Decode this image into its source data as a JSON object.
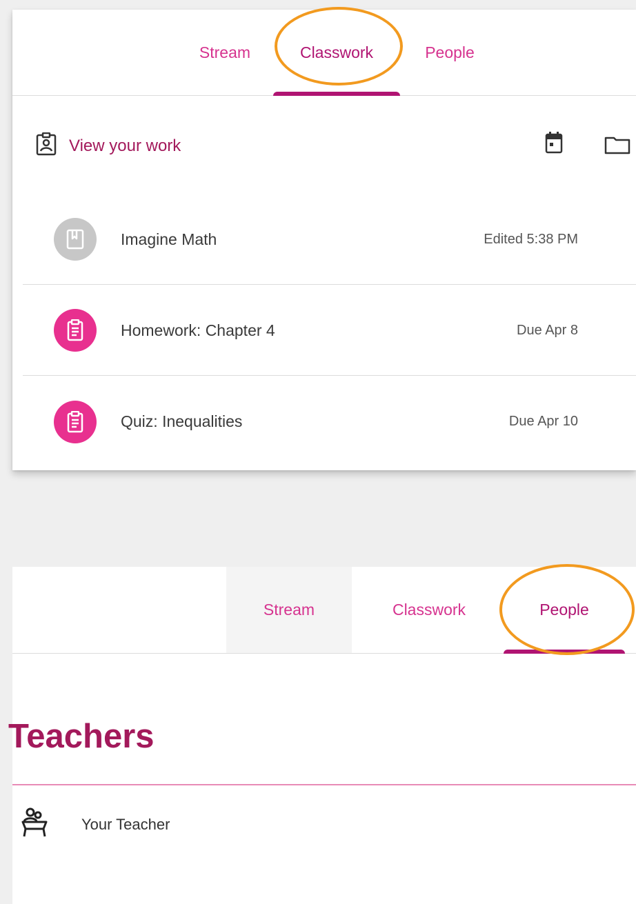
{
  "classwork_panel": {
    "tabs": [
      {
        "label": "Stream",
        "active": false
      },
      {
        "label": "Classwork",
        "active": true
      },
      {
        "label": "People",
        "active": false
      }
    ],
    "view_work": {
      "label": "View your work",
      "icon": "assignment-ind-icon"
    },
    "toolbar_icons": [
      "calendar-icon",
      "folder-icon"
    ],
    "items": [
      {
        "title": "Imagine Math",
        "meta": "Edited 5:38 PM",
        "icon": "material-icon",
        "avatar_color": "#c7c7c7"
      },
      {
        "title": "Homework: Chapter 4",
        "meta": "Due Apr 8",
        "icon": "assignment-icon",
        "avatar_color": "#e8308f"
      },
      {
        "title": "Quiz: Inequalities",
        "meta": "Due Apr 10",
        "icon": "assignment-icon",
        "avatar_color": "#e8308f"
      }
    ]
  },
  "people_panel": {
    "tabs": [
      {
        "label": "Stream",
        "active": false
      },
      {
        "label": "Classwork",
        "active": false
      },
      {
        "label": "People",
        "active": true
      }
    ],
    "section_title": "Teachers",
    "teachers": [
      {
        "name": "Your Teacher",
        "icon": "teacher-icon"
      }
    ]
  },
  "colors": {
    "accent": "#b01472",
    "tab_text": "#d6338f",
    "callout": "#f29a1f",
    "assignment_avatar": "#e8308f",
    "material_avatar": "#c7c7c7"
  }
}
